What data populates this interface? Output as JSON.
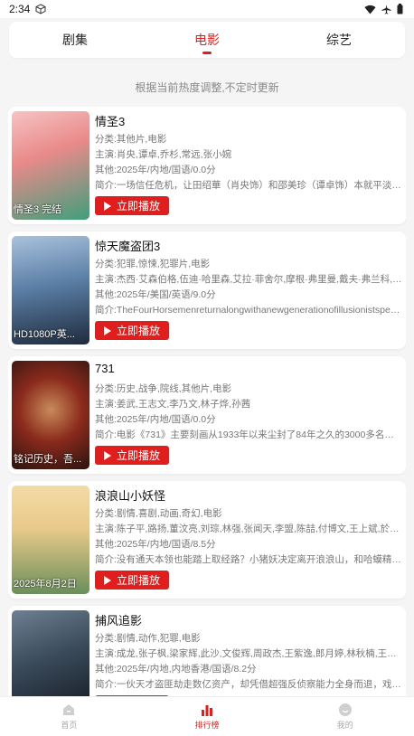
{
  "status": {
    "time": "2:34"
  },
  "tabs": [
    {
      "label": "剧集",
      "active": false
    },
    {
      "label": "电影",
      "active": true
    },
    {
      "label": "综艺",
      "active": false
    }
  ],
  "notice": "根据当前热度调整,不定时更新",
  "play_label": "立即播放",
  "movies": [
    {
      "title": "情圣3",
      "category": "分类:其他片,电影",
      "cast": "主演:肖央,谭卓,乔杉,常远,张小婉",
      "other": "其他:2025年/内地/国语/0.0分",
      "intro": "简介:一场信任危机，让田绍華（肖央饰）和邵美珍（谭卓饰）本就平淡的婚...",
      "poster_caption": "情圣3  完结",
      "poster_colors": [
        "#f2b8b8",
        "#3f9f7c"
      ]
    },
    {
      "title": "惊天魔盗团3",
      "category": "分类:犯罪,惊悚,犯罪片,电影",
      "cast": "主演:杰西·艾森伯格,伍迪·哈里森,艾拉·菲舍尔,摩根·弗里曼,戴夫·弗兰科,马克·...",
      "other": "其他:2025年/美国/英语/9.0分",
      "intro": "简介:TheFourHorsemenreturnalongwithanewgenerationofillusionistsperfor...",
      "poster_caption": "HD1080P英...",
      "poster_colors": [
        "#5b7fa6",
        "#1f2b3d"
      ]
    },
    {
      "title": "731",
      "category": "分类:历史,战争,院线,其他片,电影",
      "cast": "主演:姜武,王志文,李乃文,林子烨,孙茜",
      "other": "其他:2025年/内地/国语/0.0分",
      "intro": "简介:电影《731》主要刻画从1933年以来尘封了84年之久的3000多名祖国...",
      "poster_caption": "铭记历史，吾...",
      "poster_colors": [
        "#8a2a1c",
        "#2a1410"
      ]
    },
    {
      "title": "浪浪山小妖怪",
      "category": "分类:剧情,喜剧,动画,奇幻,电影",
      "cast": "主演:陈子平,路扬,董汶亮,刘琮,林强,张闻天,李盟,陈喆,付博文,王上斌,於水,吴...",
      "other": "其他:2025年/内地/国语/8.5分",
      "intro": "简介:没有通天本领也能踏上取经路？小猪妖决定离开浪浪山，和哈蟆精、黄...",
      "poster_caption": "2025年8月2日",
      "poster_colors": [
        "#e8c98a",
        "#6a8f5a"
      ]
    },
    {
      "title": "捕风追影",
      "category": "分类:剧情,动作,犯罪,电影",
      "cast": "主演:成龙,张子枫,梁家辉,此沙,文俊辉,周政杰,王紫逸,郎月婷,林秋楠,王振威,李...",
      "other": "其他:2025年/内地,内地香港/国语/8.2分",
      "intro": "简介:一伙天才盗匪劫走数亿资产，却凭借超强反侦察能力全身而退，戏要警...",
      "poster_caption": "",
      "poster_colors": [
        "#3a4a5a",
        "#10161d"
      ]
    }
  ],
  "bottom_nav": [
    {
      "label": "首页",
      "icon": "home-icon",
      "active": false
    },
    {
      "label": "排行榜",
      "icon": "ranking-icon",
      "active": true
    },
    {
      "label": "我的",
      "icon": "profile-icon",
      "active": false
    }
  ],
  "accent_color": "#e01e1e"
}
